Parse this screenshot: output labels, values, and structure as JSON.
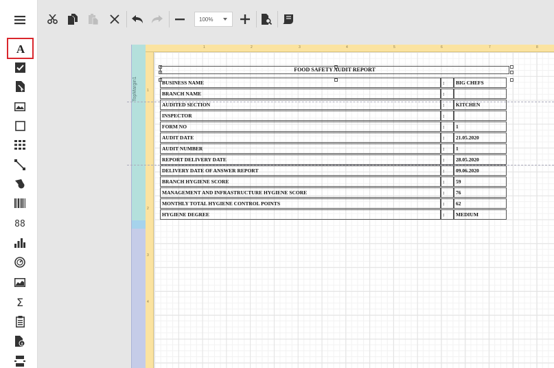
{
  "toolbar": {
    "zoom_value": "100%"
  },
  "band": {
    "label": "TopMargin1"
  },
  "ruler": {
    "horizontal_marks": [
      "1",
      "2",
      "3",
      "4",
      "5",
      "6",
      "7",
      "8"
    ],
    "vertical_marks": [
      "1",
      "2",
      "3",
      "4"
    ]
  },
  "report": {
    "title": "FOOD SAFETY AUDIT REPORT",
    "rows": [
      {
        "label": "BUSINESS NAME",
        "sep": ":",
        "value": "BIG CHEFS"
      },
      {
        "label": "BRANCH NAME",
        "sep": ":",
        "value": ""
      },
      {
        "label": "AUDITED SECTION",
        "sep": ":",
        "value": "KITCHEN"
      },
      {
        "label": "INSPECTOR",
        "sep": ":",
        "value": ""
      },
      {
        "label": "FORM NO",
        "sep": ":",
        "value": "1"
      },
      {
        "label": "AUDIT DATE",
        "sep": ":",
        "value": "21.05.2020"
      },
      {
        "label": "AUDIT NUMBER",
        "sep": ":",
        "value": "1"
      },
      {
        "label": "REPORT DELIVERY DATE",
        "sep": ":",
        "value": "28.05.2020"
      },
      {
        "label": "DELIVERY DATE OF ANSWER REPORT",
        "sep": ":",
        "value": "09.06.2020"
      },
      {
        "label": "BRANCH HYGIENE SCORE",
        "sep": ":",
        "value": "59"
      },
      {
        "label": "MANAGEMENT AND INFRASTRUCTURE HYGIENE SCORE",
        "sep": ":",
        "value": "76"
      },
      {
        "label": "MONTHLY TOTAL HYGIENE CONTROL POINTS",
        "sep": ":",
        "value": "62"
      },
      {
        "label": "HYGIENE DEGREE",
        "sep": ":",
        "value": "MEDIUM"
      }
    ]
  },
  "colors": {
    "accent": "#d9262c",
    "ruler": "#fbe3a0",
    "band_top": "#b4e0dc",
    "band_bottom": "#c5cce8"
  },
  "icons": {
    "toolbox": [
      "label-icon",
      "checkbox-icon",
      "rich-text-icon",
      "picture-box-icon",
      "panel-icon",
      "table-icon",
      "line-icon",
      "shape-icon",
      "barcode-icon",
      "zip-code-icon",
      "chart-icon",
      "gauge-icon",
      "sparkline-icon",
      "summary-icon",
      "page-info-icon",
      "character-comb-icon",
      "page-break-icon"
    ],
    "toolbar": [
      "cut-icon",
      "copy-icon",
      "paste-icon",
      "delete-icon",
      "undo-icon",
      "redo-icon",
      "zoom-out-icon",
      "zoom-in-icon",
      "preview-icon",
      "scripts-icon"
    ]
  }
}
